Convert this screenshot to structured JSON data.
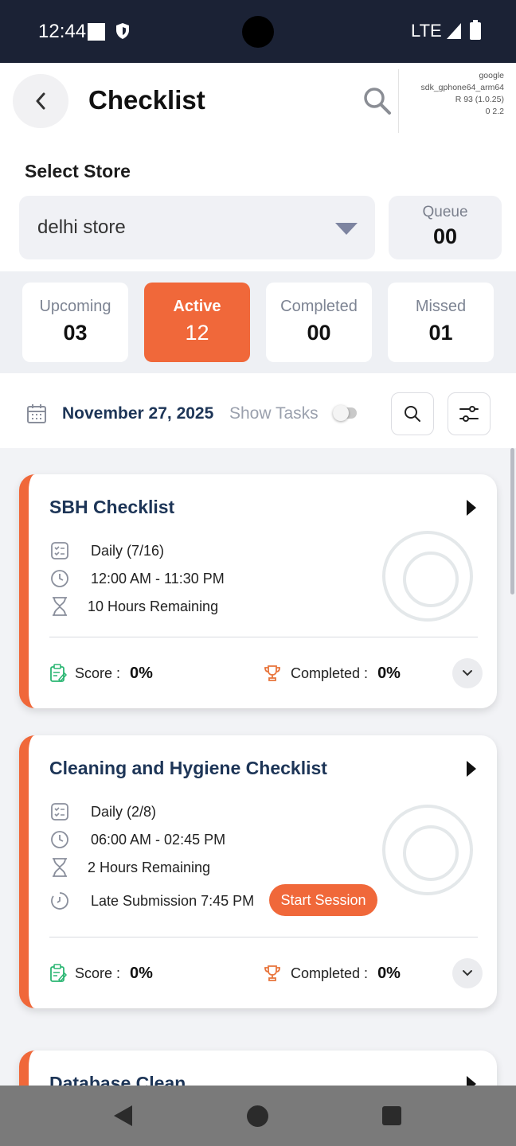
{
  "status_bar": {
    "time": "12:44",
    "network": "LTE"
  },
  "header": {
    "title": "Checklist",
    "device_info": [
      "google",
      "sdk_gphone64_arm64",
      "R 93 (1.0.25)",
      "0 2.2"
    ]
  },
  "store": {
    "label": "Select Store",
    "selected": "delhi store",
    "queue_label": "Queue",
    "queue_count": "00"
  },
  "tabs": [
    {
      "label": "Upcoming",
      "count": "03"
    },
    {
      "label": "Active",
      "count": "12"
    },
    {
      "label": "Completed",
      "count": "00"
    },
    {
      "label": "Missed",
      "count": "01"
    }
  ],
  "date_row": {
    "date": "November 27, 2025",
    "show_tasks_label": "Show Tasks",
    "show_tasks_on": false
  },
  "cards": [
    {
      "title": "SBH Checklist",
      "frequency": "Daily (7/16)",
      "time_range": "12:00 AM - 11:30 PM",
      "remaining": "10 Hours Remaining",
      "score_label": "Score :",
      "score": "0%",
      "completed_label": "Completed :",
      "completed": "0%"
    },
    {
      "title": "Cleaning and Hygiene Checklist",
      "frequency": "Daily (2/8)",
      "time_range": "06:00 AM - 02:45 PM",
      "remaining": "2 Hours Remaining",
      "late_submission": "Late Submission 7:45 PM",
      "start_session_label": "Start Session",
      "score_label": "Score :",
      "score": "0%",
      "completed_label": "Completed :",
      "completed": "0%"
    },
    {
      "title": "Database Clean"
    }
  ],
  "colors": {
    "accent": "#f0683a",
    "title_navy": "#1d3557",
    "status_bar": "#1b2235",
    "score_icon": "#2bb673"
  }
}
